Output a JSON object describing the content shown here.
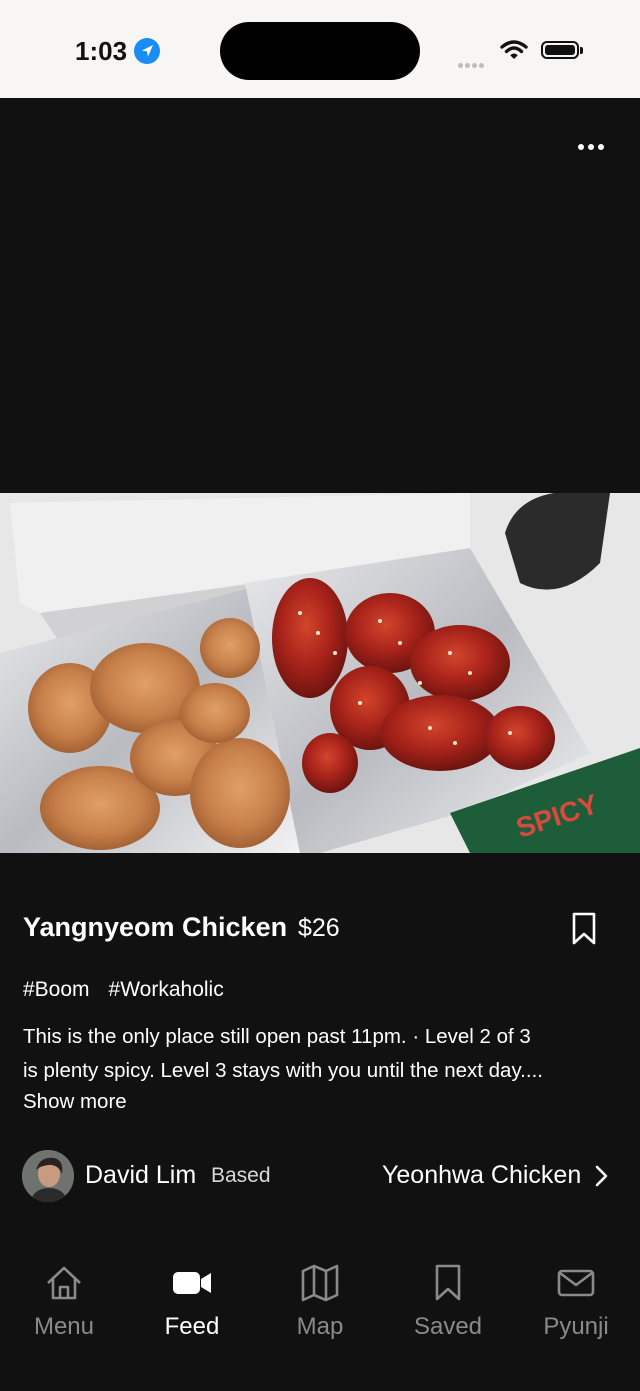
{
  "status_bar": {
    "time": "1:03"
  },
  "post": {
    "title": "Yangnyeom Chicken",
    "price": "$26",
    "tags": [
      "#Boom",
      "#Workaholic"
    ],
    "description_line1": "This is the only place still open past 11pm.  ·  Level 2 of 3",
    "description_line2": "is plenty spicy. Level 3 stays with you until the next day....",
    "show_more": "Show more",
    "author": "David Lim",
    "author_badge": "Based",
    "restaurant": "Yeonhwa Chicken"
  },
  "tabbar": {
    "items": [
      {
        "label": "Menu",
        "icon": "home-icon"
      },
      {
        "label": "Feed",
        "icon": "video-icon",
        "active": true
      },
      {
        "label": "Map",
        "icon": "map-icon"
      },
      {
        "label": "Saved",
        "icon": "bookmark-icon"
      },
      {
        "label": "Pyunji",
        "icon": "mail-icon"
      }
    ]
  },
  "colors": {
    "background": "#121111",
    "status_bar": "#f7f6f4",
    "location_blue": "#1a8cf5",
    "inactive_tab": "#8a8a8a"
  }
}
